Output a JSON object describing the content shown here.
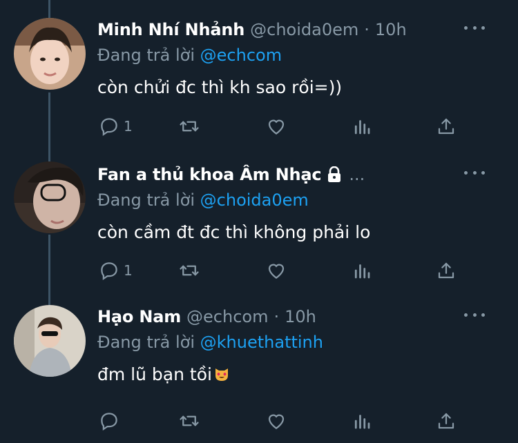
{
  "colors": {
    "background": "#15202b",
    "secondary_text": "#8899a6",
    "link": "#1da1f2",
    "thread_line": "#3d5466"
  },
  "tweets": [
    {
      "name": "Minh Nhí Nhảnh",
      "handle": "@choida0em",
      "separator": "·",
      "time": "10h",
      "reply_prefix": "Đang trả lời",
      "reply_to": "@echcom",
      "text": "còn chửi đc thì kh sao rồi=))",
      "reply_count": "1",
      "icons": [
        "more-icon",
        "reply-icon",
        "retweet-icon",
        "like-icon",
        "analytics-icon",
        "share-icon"
      ]
    },
    {
      "name": "Fan a thủ khoa Âm Nhạc",
      "protected_icon": "lock-icon",
      "truncation": "...",
      "reply_prefix": "Đang trả lời",
      "reply_to": "@choida0em",
      "text": "còn cầm đt đc thì không phải lo",
      "reply_count": "1",
      "icons": [
        "more-icon",
        "reply-icon",
        "retweet-icon",
        "like-icon",
        "analytics-icon",
        "share-icon"
      ]
    },
    {
      "name": "Hạo Nam",
      "handle": "@echcom",
      "separator": "·",
      "time": "10h",
      "reply_prefix": "Đang trả lời",
      "reply_to": "@khuethattinh",
      "text": "đm lũ bạn tồi",
      "emoji": "heart-eyes-cat-emoji",
      "reply_count": "",
      "icons": [
        "more-icon",
        "reply-icon",
        "retweet-icon",
        "like-icon",
        "analytics-icon",
        "share-icon"
      ]
    }
  ]
}
